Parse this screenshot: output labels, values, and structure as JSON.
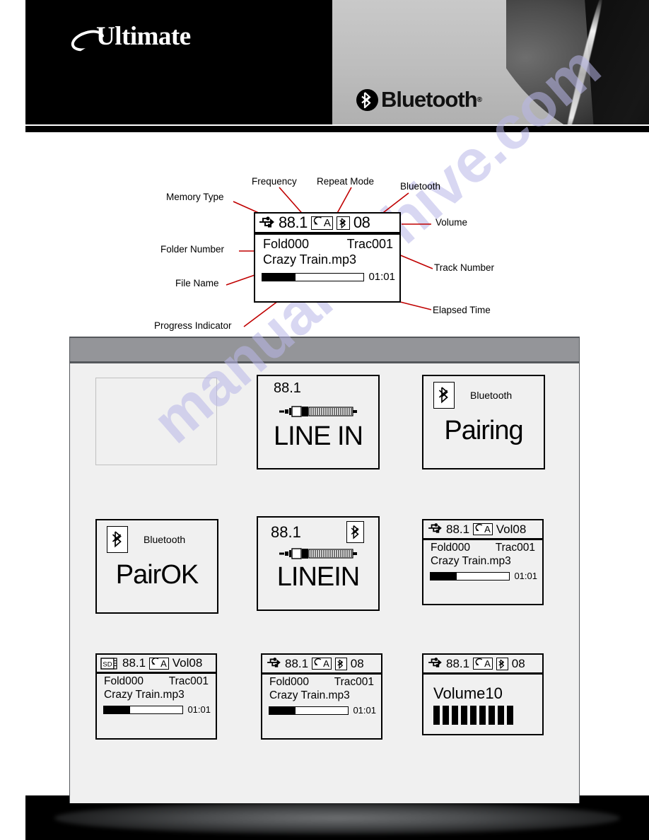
{
  "header": {
    "brand": "Ultimate",
    "bluetooth_logo": "Bluetooth",
    "bluetooth_registered": "®",
    "brand_swoosh_icon": "swoosh-icon",
    "bluetooth_mark_icon": "bluetooth-icon"
  },
  "watermark": {
    "text": "manualarchive.com"
  },
  "diagram": {
    "annotations": {
      "memory_type": "Memory Type",
      "frequency": "Frequency",
      "repeat_mode": "Repeat Mode",
      "bluetooth": "Bluetooth",
      "volume": "Volume",
      "folder_number": "Folder Number",
      "track_number": "Track Number",
      "file_name": "File Name",
      "elapsed_time": "Elapsed Time",
      "progress_indicator": "Progress Indicator"
    },
    "screen": {
      "memory_icon": "usb-icon",
      "frequency": "88.1",
      "repeat_icon": "repeat-arrow-icon",
      "repeat_letter": "A",
      "bluetooth_icon": "bluetooth-icon",
      "volume": "08",
      "folder": "Fold000",
      "track": "Trac001",
      "file_name": "Crazy Train.mp3",
      "elapsed": "01:01",
      "progress_percent": 33
    }
  },
  "panel": {
    "screens": [
      {
        "id": "blank",
        "type": "empty"
      },
      {
        "id": "line-in-fm",
        "type": "linein",
        "frequency": "88.1",
        "label": "LINE IN",
        "jack_icon": "audio-jack-icon",
        "bluetooth_icon": null
      },
      {
        "id": "bt-pairing",
        "type": "bluetooth",
        "bluetooth_icon": "bluetooth-icon",
        "caption": "Bluetooth",
        "label": "Pairing"
      },
      {
        "id": "bt-pairok",
        "type": "bluetooth",
        "bluetooth_icon": "bluetooth-icon",
        "caption": "Bluetooth",
        "label": "PairOK"
      },
      {
        "id": "line-in-bt",
        "type": "linein",
        "frequency": "88.1",
        "label": "LINEIN",
        "jack_icon": "audio-jack-icon",
        "bluetooth_icon": "bluetooth-icon"
      },
      {
        "id": "usb-play-vol",
        "type": "player",
        "memory_icon": "usb-icon",
        "frequency": "88.1",
        "repeat_icon": "repeat-arrow-icon",
        "repeat_letter": "A",
        "bluetooth_icon": null,
        "volume": "Vol08",
        "folder": "Fold000",
        "track": "Trac001",
        "file_name": "Crazy Train.mp3",
        "elapsed": "01:01",
        "progress_percent": 33
      },
      {
        "id": "sd-play-vol",
        "type": "player",
        "memory_icon": "sd-card-icon",
        "frequency": "88.1",
        "repeat_icon": "repeat-arrow-icon",
        "repeat_letter": "A",
        "bluetooth_icon": null,
        "volume": "Vol08",
        "folder": "Fold000",
        "track": "Trac001",
        "file_name": "Crazy Train.mp3",
        "elapsed": "01:01",
        "progress_percent": 33
      },
      {
        "id": "usb-play-bt",
        "type": "player",
        "memory_icon": "usb-icon",
        "frequency": "88.1",
        "repeat_icon": "repeat-arrow-icon",
        "repeat_letter": "A",
        "bluetooth_icon": "bluetooth-icon",
        "volume": "08",
        "folder": "Fold000",
        "track": "Trac001",
        "file_name": "Crazy Train.mp3",
        "elapsed": "01:01",
        "progress_percent": 33
      },
      {
        "id": "usb-volume",
        "type": "volume",
        "memory_icon": "usb-icon",
        "frequency": "88.1",
        "repeat_icon": "repeat-arrow-icon",
        "repeat_letter": "A",
        "bluetooth_icon": "bluetooth-icon",
        "volume": "08",
        "label": "Volume10",
        "bars": 9
      }
    ],
    "sd_icon_text": "SD"
  },
  "colors": {
    "banner_black": "#000000",
    "banner_grey": "#bdbdbd",
    "panel_bg": "#f0f0f0",
    "panel_bar": "#949599",
    "leader_line": "#c00000",
    "watermark": "#b9b7e8"
  }
}
